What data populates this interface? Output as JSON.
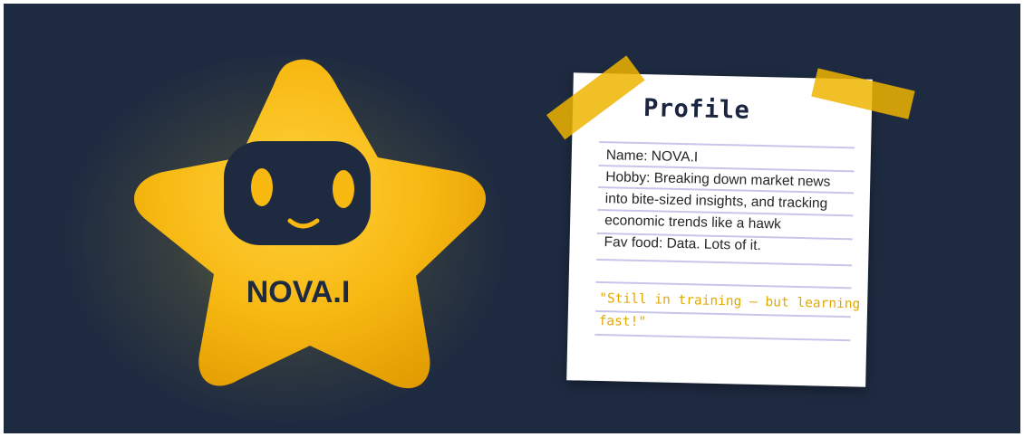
{
  "mascot": {
    "name": "NOVA.I",
    "colors": {
      "star": "#f7b812",
      "face": "#1e2a40",
      "eyes": "#f7b812",
      "background": "#1e2a40"
    }
  },
  "profile": {
    "title": "Profile",
    "lines": [
      "Name: NOVA.I",
      "Hobby: Breaking down market news",
      "into bite-sized insights, and tracking",
      "economic trends like a hawk",
      "Fav food: Data. Lots of it."
    ],
    "quote_lines": [
      "\"Still in training — but learning",
      "fast!\""
    ],
    "colors": {
      "tape": "#eeb400",
      "rule": "#c7c6ea",
      "quote": "#e0a800",
      "title": "#1b2540"
    }
  }
}
